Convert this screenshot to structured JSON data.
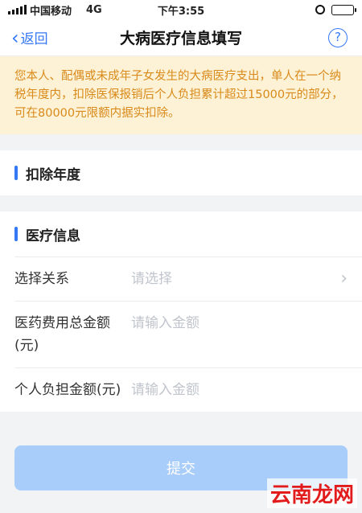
{
  "status_bar": {
    "carrier": "中国移动",
    "network": "4G",
    "time": "下午3:55"
  },
  "nav": {
    "back_label": "返回",
    "title": "大病医疗信息填写",
    "help_label": "?"
  },
  "notice": {
    "text": "您本人、配偶或未成年子女发生的大病医疗支出，单人在一个纳税年度内，扣除医保报销后个人负担累计超过15000元的部分，可在80000元限额内据实扣除。"
  },
  "deduction_year": {
    "title": "扣除年度"
  },
  "medical_info": {
    "title": "医疗信息",
    "relation": {
      "label": "选择关系",
      "placeholder": "请选择"
    },
    "total_amount": {
      "label": "医药费用总金额(元)",
      "placeholder": "请输入金额"
    },
    "personal_amount": {
      "label": "个人负担金额(元)",
      "placeholder": "请输入金额"
    }
  },
  "submit_label": "提交",
  "watermark": "云南龙网",
  "colors": {
    "accent": "#3478f6",
    "notice_bg": "#fdf2d6",
    "notice_text": "#d98a1a",
    "submit_disabled": "#a9cdfa"
  }
}
